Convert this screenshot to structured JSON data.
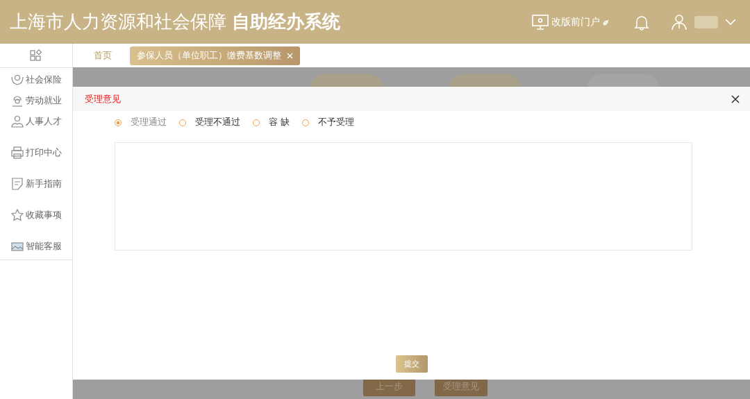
{
  "header": {
    "title": "上海市人力资源和社会保障",
    "title_bold": "自助经办系统",
    "portal_link": "改版前门户"
  },
  "sidebar": {
    "items": [
      {
        "label": "社会保险",
        "kind": "hands"
      },
      {
        "label": "劳动就业",
        "kind": "worker"
      },
      {
        "label": "人事人才",
        "kind": "people"
      },
      {
        "label": "打印中心",
        "kind": "printer"
      },
      {
        "label": "新手指南",
        "kind": "note"
      },
      {
        "label": "收藏事项",
        "kind": "star"
      },
      {
        "label": "智能客服",
        "kind": "screen"
      }
    ]
  },
  "tabs": [
    {
      "label": "首页",
      "selected": false,
      "closable": false
    },
    {
      "label": "参保人员（单位职工）缴费基数调整",
      "selected": true,
      "closable": true
    }
  ],
  "background": {
    "buttons": [
      "上一步",
      "受理意见"
    ]
  },
  "dialog": {
    "title": "受理意见",
    "options": [
      {
        "label": "受理通过",
        "selected": true
      },
      {
        "label": "受理不通过",
        "selected": false
      },
      {
        "label": "容 缺",
        "selected": false
      },
      {
        "label": "不予受理",
        "selected": false
      }
    ],
    "submit": "提交"
  }
}
